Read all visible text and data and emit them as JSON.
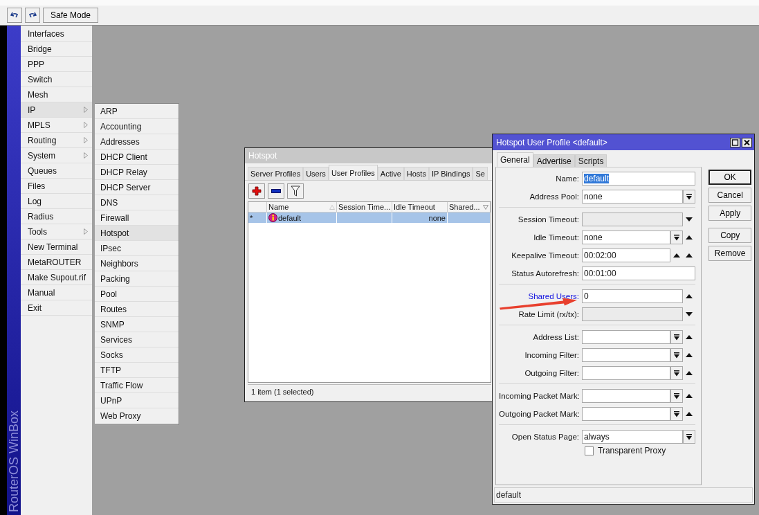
{
  "toolbar": {
    "buttons": [
      {
        "kind": "undo"
      },
      {
        "kind": "redo"
      },
      {
        "kind": "text",
        "label": "Safe Mode"
      }
    ]
  },
  "sidebar": {
    "brand": "RouterOS WinBox",
    "items": [
      {
        "label": "Interfaces",
        "submenu": false,
        "selected": false
      },
      {
        "label": "Bridge",
        "submenu": false,
        "selected": false
      },
      {
        "label": "PPP",
        "submenu": false,
        "selected": false
      },
      {
        "label": "Switch",
        "submenu": false,
        "selected": false
      },
      {
        "label": "Mesh",
        "submenu": false,
        "selected": false
      },
      {
        "label": "IP",
        "submenu": true,
        "selected": true
      },
      {
        "label": "MPLS",
        "submenu": true,
        "selected": false
      },
      {
        "label": "Routing",
        "submenu": true,
        "selected": false
      },
      {
        "label": "System",
        "submenu": true,
        "selected": false
      },
      {
        "label": "Queues",
        "submenu": false,
        "selected": false
      },
      {
        "label": "Files",
        "submenu": false,
        "selected": false
      },
      {
        "label": "Log",
        "submenu": false,
        "selected": false
      },
      {
        "label": "Radius",
        "submenu": false,
        "selected": false
      },
      {
        "label": "Tools",
        "submenu": true,
        "selected": false
      },
      {
        "label": "New Terminal",
        "submenu": false,
        "selected": false
      },
      {
        "label": "MetaROUTER",
        "submenu": false,
        "selected": false
      },
      {
        "label": "Make Supout.rif",
        "submenu": false,
        "selected": false
      },
      {
        "label": "Manual",
        "submenu": false,
        "selected": false
      },
      {
        "label": "Exit",
        "submenu": false,
        "selected": false
      }
    ]
  },
  "submenu": {
    "items": [
      {
        "label": "ARP",
        "selected": false
      },
      {
        "label": "Accounting",
        "selected": false
      },
      {
        "label": "Addresses",
        "selected": false
      },
      {
        "label": "DHCP Client",
        "selected": false
      },
      {
        "label": "DHCP Relay",
        "selected": false
      },
      {
        "label": "DHCP Server",
        "selected": false
      },
      {
        "label": "DNS",
        "selected": false
      },
      {
        "label": "Firewall",
        "selected": false
      },
      {
        "label": "Hotspot",
        "selected": true
      },
      {
        "label": "IPsec",
        "selected": false
      },
      {
        "label": "Neighbors",
        "selected": false
      },
      {
        "label": "Packing",
        "selected": false
      },
      {
        "label": "Pool",
        "selected": false
      },
      {
        "label": "Routes",
        "selected": false
      },
      {
        "label": "SNMP",
        "selected": false
      },
      {
        "label": "Services",
        "selected": false
      },
      {
        "label": "Socks",
        "selected": false
      },
      {
        "label": "TFTP",
        "selected": false
      },
      {
        "label": "Traffic Flow",
        "selected": false
      },
      {
        "label": "UPnP",
        "selected": false
      },
      {
        "label": "Web Proxy",
        "selected": false
      }
    ]
  },
  "hotspot_window": {
    "title": "Hotspot",
    "tabs": [
      {
        "label": "Server Profiles",
        "selected": false
      },
      {
        "label": "Users",
        "selected": false
      },
      {
        "label": "User Profiles",
        "selected": true
      },
      {
        "label": "Active",
        "selected": false
      },
      {
        "label": "Hosts",
        "selected": false
      },
      {
        "label": "IP Bindings",
        "selected": false
      },
      {
        "label": "Se",
        "selected": false
      }
    ],
    "toolbar": [
      {
        "kind": "add"
      },
      {
        "kind": "remove"
      },
      {
        "kind": "filter"
      }
    ],
    "table": {
      "columns": [
        {
          "label": "Name",
          "sort_indicator": {
            "kind": "up"
          }
        },
        {
          "label": "Session Time..."
        },
        {
          "label": "Idle Timeout"
        },
        {
          "label": "Shared...",
          "sort_indicator": {
            "kind": "down"
          }
        }
      ],
      "rows": [
        {
          "marker": "*",
          "name": "default",
          "idle_timeout": "none",
          "selected": true
        }
      ]
    },
    "status": "1 item (1 selected)"
  },
  "dialog": {
    "title": "Hotspot User Profile <default>",
    "tabs": [
      {
        "label": "General",
        "selected": true
      },
      {
        "label": "Advertise",
        "selected": false
      },
      {
        "label": "Scripts",
        "selected": false
      }
    ],
    "groups": [
      [
        {
          "label": "Name:",
          "value": "default",
          "value_selected": true
        },
        {
          "label": "Address Pool:",
          "value": "none",
          "buttons": [
            {
              "kind": "dropdown"
            }
          ]
        }
      ],
      [
        {
          "label": "Session Timeout:",
          "disabled": true,
          "buttons": [
            {
              "kind": "down"
            }
          ]
        },
        {
          "label": "Idle Timeout:",
          "value": "none",
          "buttons": [
            {
              "kind": "dropdown"
            },
            {
              "kind": "up"
            }
          ]
        },
        {
          "label": "Keepalive Timeout:",
          "value": "00:02:00",
          "buttons": [
            {
              "kind": "up"
            },
            {
              "kind": "up"
            }
          ]
        },
        {
          "label": "Status Autorefresh:",
          "value": "00:01:00"
        }
      ],
      [
        {
          "label": "Shared Users:",
          "value": "0",
          "highlighted": true,
          "buttons": [
            {
              "kind": "up"
            }
          ]
        },
        {
          "label": "Rate Limit (rx/tx):",
          "disabled": true,
          "buttons": [
            {
              "kind": "down"
            }
          ]
        }
      ],
      [
        {
          "label": "Address List:",
          "buttons": [
            {
              "kind": "dropdown"
            },
            {
              "kind": "up"
            }
          ]
        },
        {
          "label": "Incoming Filter:",
          "buttons": [
            {
              "kind": "dropdown"
            },
            {
              "kind": "up"
            }
          ]
        },
        {
          "label": "Outgoing Filter:",
          "buttons": [
            {
              "kind": "dropdown"
            },
            {
              "kind": "up"
            }
          ]
        }
      ],
      [
        {
          "label": "Incoming Packet Mark:",
          "buttons": [
            {
              "kind": "dropdown"
            },
            {
              "kind": "up"
            }
          ]
        },
        {
          "label": "Outgoing Packet Mark:",
          "buttons": [
            {
              "kind": "dropdown"
            },
            {
              "kind": "up"
            }
          ]
        }
      ],
      [
        {
          "label": "Open Status Page:",
          "value": "always",
          "buttons": [
            {
              "kind": "dropdown"
            }
          ]
        }
      ]
    ],
    "checkbox": {
      "label": "Transparent Proxy",
      "checked": false
    },
    "button_groups": [
      [
        {
          "label": "OK",
          "default": true
        },
        {
          "label": "Cancel",
          "default": false
        },
        {
          "label": "Apply",
          "default": false
        }
      ],
      [
        {
          "label": "Copy",
          "default": false
        },
        {
          "label": "Remove",
          "default": false
        }
      ]
    ],
    "status": "default"
  }
}
